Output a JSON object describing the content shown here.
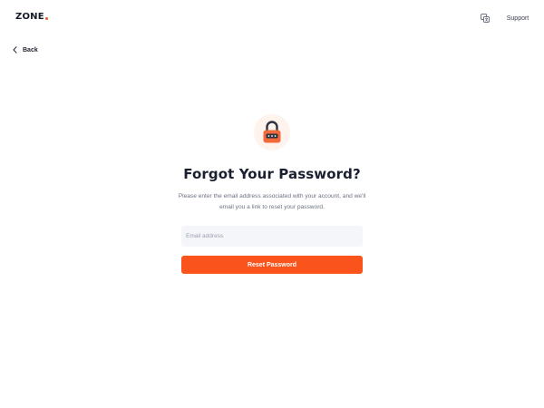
{
  "brand": {
    "name": "ZONE",
    "accent_color": "#f05a28"
  },
  "header": {
    "language_icon": "language-translate-icon",
    "support_label": "Support"
  },
  "nav": {
    "back_label": "Back",
    "back_icon": "chevron-left-icon"
  },
  "main": {
    "icon": "padlock-icon",
    "title": "Forgot Your Password?",
    "description": "Please enter the email address associated with your account, and we'll email you a link to reset your password.",
    "email_placeholder": "Email address",
    "email_value": "",
    "submit_label": "Reset Password",
    "button_color": "#fa541c"
  }
}
